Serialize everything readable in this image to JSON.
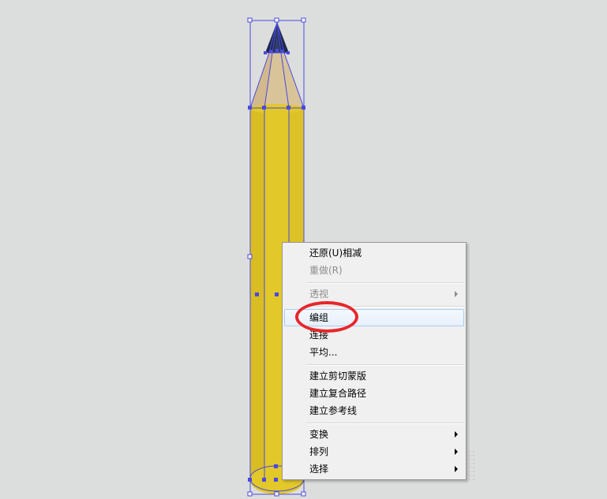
{
  "context_menu": {
    "items": [
      {
        "label": "还原(U)相减",
        "enabled": true,
        "submenu": false
      },
      {
        "label": "重做(R)",
        "enabled": false,
        "submenu": false
      },
      {
        "label": "透视",
        "enabled": false,
        "submenu": true
      },
      {
        "label": "编组",
        "enabled": true,
        "submenu": false,
        "highlighted": true
      },
      {
        "label": "连接",
        "enabled": true,
        "submenu": false
      },
      {
        "label": "平均...",
        "enabled": true,
        "submenu": false
      },
      {
        "label": "建立剪切蒙版",
        "enabled": true,
        "submenu": false
      },
      {
        "label": "建立复合路径",
        "enabled": true,
        "submenu": false
      },
      {
        "label": "建立参考线",
        "enabled": true,
        "submenu": false
      },
      {
        "label": "变换",
        "enabled": true,
        "submenu": true
      },
      {
        "label": "排列",
        "enabled": true,
        "submenu": true
      },
      {
        "label": "选择",
        "enabled": true,
        "submenu": true
      }
    ]
  },
  "artwork": {
    "object": "pencil",
    "body_color": "#e3c82a",
    "wood_color": "#d9c49a",
    "tip_color": "#1f2a4a",
    "selection_color": "#4a4ae0"
  },
  "annotation": {
    "color": "#e8262a",
    "target": "编组"
  }
}
